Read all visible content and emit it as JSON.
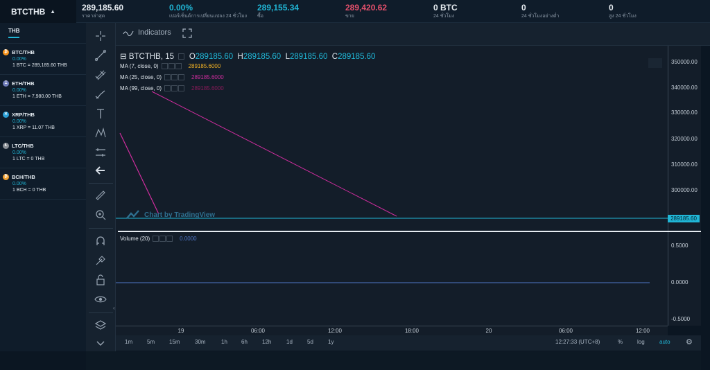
{
  "pair": "BTCTHB",
  "stats": [
    {
      "value": "289,185.60",
      "label": "ราคาล่าสุด",
      "color": "#e9eef3"
    },
    {
      "value": "0.00%",
      "label": "เปอร์เซ็นต์การเปลี่ยนแปลง 24 ชั่วโมง",
      "color": "#20b6d6"
    },
    {
      "value": "289,155.34",
      "label": "ซื้อ",
      "color": "#20b6d6"
    },
    {
      "value": "289,420.62",
      "label": "ขาย",
      "color": "#e8516d"
    },
    {
      "value": "0 BTC",
      "label": "24 ชั่วโมง",
      "color": "#e9eef3"
    },
    {
      "value": "0",
      "label": "24 ชั่วโมงอย่างต่ำ",
      "color": "#e9eef3"
    },
    {
      "value": "0",
      "label": "สูง 24 ชั่วโมง",
      "color": "#e9eef3"
    }
  ],
  "sidebar": {
    "tab": "THB",
    "coins": [
      {
        "icon": "bitcoin-icon",
        "glyph": "₿",
        "color": "#f7931a",
        "name": "BTC/THB",
        "change": "0.00%",
        "rate": "1 BTC = 289,185.60 THB"
      },
      {
        "icon": "ethereum-icon",
        "glyph": "Ξ",
        "color": "#6f7cba",
        "name": "ETH/THB",
        "change": "0.00%",
        "rate": "1 ETH = 7,980.00 THB"
      },
      {
        "icon": "ripple-icon",
        "glyph": "✕",
        "color": "#2a9fd6",
        "name": "XRP/THB",
        "change": "0.00%",
        "rate": "1 XRP = 11.07 THB"
      },
      {
        "icon": "litecoin-icon",
        "glyph": "Ł",
        "color": "#8a8f96",
        "name": "LTC/THB",
        "change": "0.00%",
        "rate": "1 LTC = 0 THB"
      },
      {
        "icon": "bitcoin-cash-icon",
        "glyph": "₿",
        "color": "#f0a030",
        "name": "BCH/THB",
        "change": "0.00%",
        "rate": "1 BCH = 0 THB"
      }
    ]
  },
  "chart_head": {
    "indicators_label": "Indicators"
  },
  "legend": {
    "symbol": "BTCTHB, 15",
    "o_label": "O",
    "o": "289185.60",
    "h_label": "H",
    "h": "289185.60",
    "l_label": "L",
    "l": "289185.60",
    "c_label": "C",
    "c": "289185.60"
  },
  "ma": [
    {
      "label": "MA (7, close, 0)",
      "value": "289185.6000",
      "color": "#f4b324"
    },
    {
      "label": "MA (25, close, 0)",
      "value": "289185.6000",
      "color": "#cf2d9e"
    },
    {
      "label": "MA (99, close, 0)",
      "value": "289185.6000",
      "color": "#8a1a5a"
    }
  ],
  "volume": {
    "label": "Volume (20)",
    "value": "0.0000",
    "color": "#4f77c8"
  },
  "watermark": "Chart by TradingView",
  "price_axis": [
    "350000.00",
    "340000.00",
    "330000.00",
    "320000.00",
    "310000.00",
    "300000.00"
  ],
  "current_price": "289185.60",
  "volume_axis": [
    "0.5000",
    "0.0000",
    "-0.5000"
  ],
  "time_axis": [
    "19",
    "06:00",
    "12:00",
    "18:00",
    "20",
    "06:00",
    "12:00"
  ],
  "timeframes": [
    "1m",
    "5m",
    "15m",
    "30m",
    "1h",
    "6h",
    "12h",
    "1d",
    "5d",
    "1y"
  ],
  "bottom_right": {
    "clock": "12:27:33 (UTC+8)",
    "percent": "%",
    "log": "log",
    "auto": "auto"
  },
  "colors": {
    "accent": "#20b6d6",
    "ask": "#e8516d",
    "bg": "#0b1622"
  }
}
